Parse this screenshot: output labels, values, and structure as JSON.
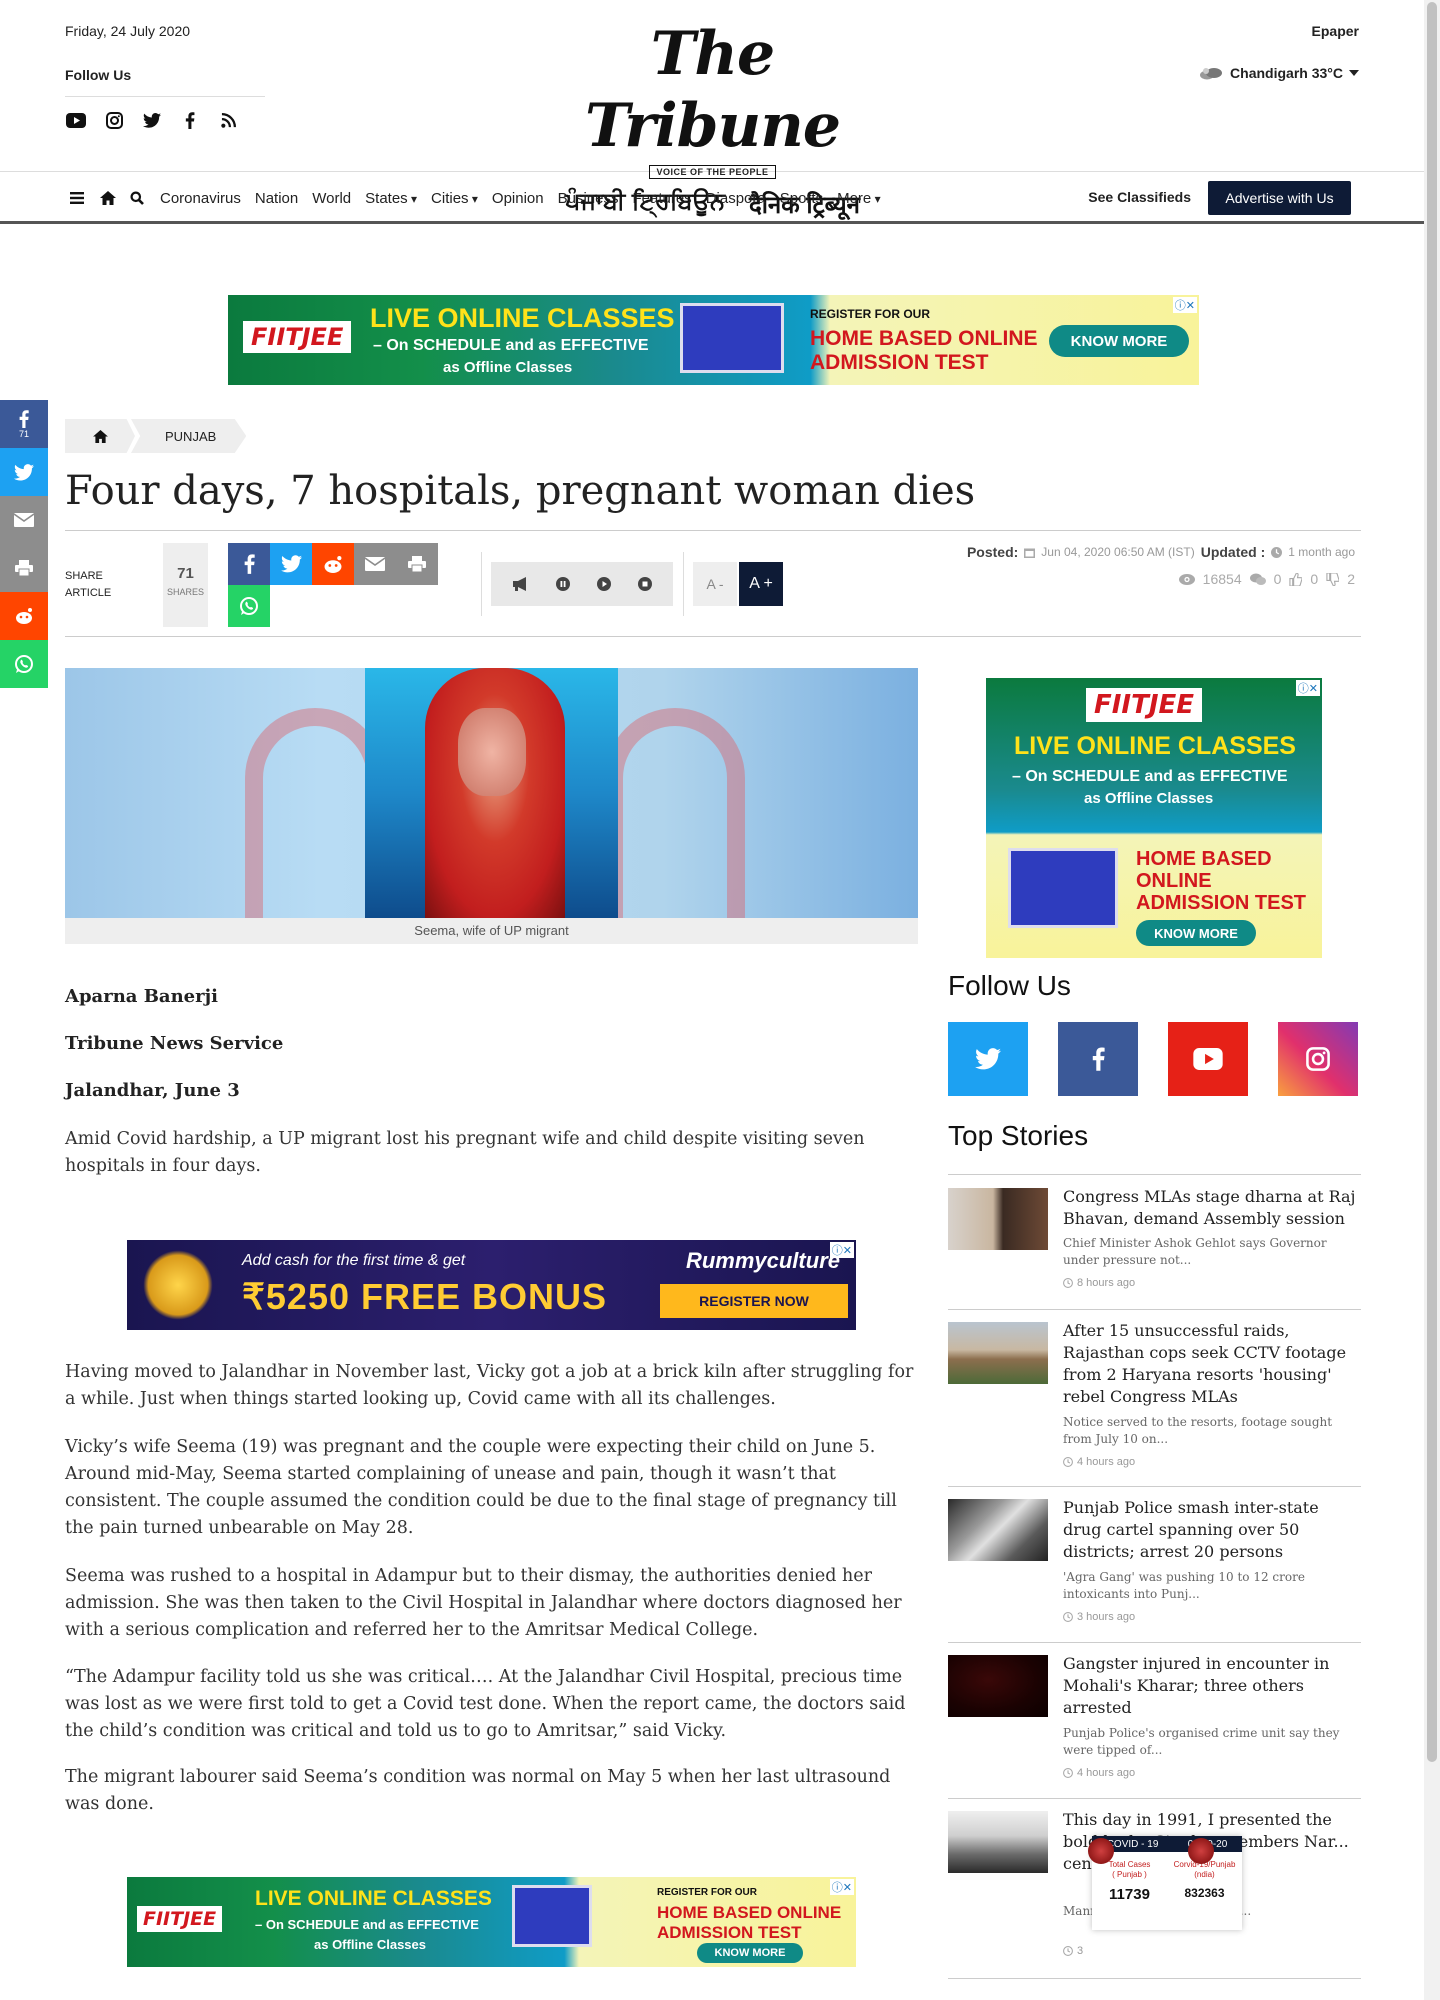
{
  "header": {
    "date": "Friday, 24 July 2020",
    "follow_us": "Follow Us",
    "logo_main": "The Tribune",
    "logo_tagline": "VOICE OF THE PEOPLE",
    "logo_punjabi": "ਪੰਜਾਬੀ ਟ੍ਰਿਬਿਊਨ",
    "logo_hindi": "दैनिक ट्रिब्यून",
    "epaper": "Epaper",
    "weather": "Chandigarh 33°C",
    "social_icons": [
      "youtube-icon",
      "instagram-icon",
      "twitter-icon",
      "facebook-icon",
      "rss-icon"
    ]
  },
  "nav": {
    "items": [
      "Coronavirus",
      "Nation",
      "World",
      "States",
      "Cities",
      "Opinion",
      "Business",
      "Features",
      "Diaspora",
      "Sports",
      "More"
    ],
    "dropdowns": [
      "States",
      "Cities",
      "More"
    ],
    "see_classifieds": "See Classifieds",
    "advertise": "Advertise with Us"
  },
  "ads": {
    "fiitjee_brand": "FIITJEE",
    "fiitjee_live": "LIVE ONLINE CLASSES",
    "fiitjee_sub1": "– On SCHEDULE and as EFFECTIVE",
    "fiitjee_sub2": "as Offline Classes",
    "fiitjee_register": "REGISTER FOR OUR",
    "fiitjee_home1": "HOME BASED ONLINE",
    "fiitjee_home2": "ADMISSION TEST",
    "fiitjee_home_side1": "HOME BASED",
    "fiitjee_home_side2": "ONLINE",
    "fiitjee_home_side3": "ADMISSION TEST",
    "fiitjee_know": "KNOW MORE",
    "rummy_line1": "Add cash for the first time & get",
    "rummy_bonus": "₹5250 FREE BONUS",
    "rummy_logo": "Rummyculture",
    "rummy_register": "REGISTER NOW"
  },
  "float_share": {
    "facebook_count": "71"
  },
  "breadcrumb": {
    "section": "PUNJAB"
  },
  "article": {
    "headline": "Four days, 7 hospitals, pregnant woman dies",
    "share_label_1": "SHARE",
    "share_label_2": "ARTICLE",
    "share_count": "71",
    "shares_word": "SHARES",
    "font_minus": "A -",
    "font_plus": "A +",
    "posted_label": "Posted:",
    "posted_date": "Jun 04, 2020 06:50 AM (IST)",
    "updated_label": "Updated :",
    "updated_ago": "1 month ago",
    "views": "16854",
    "comments": "0",
    "likes": "0",
    "dislikes": "2",
    "caption": "Seema, wife of UP migrant",
    "author": "Aparna Banerji",
    "agency": "Tribune News Service",
    "dateline": "Jalandhar, June 3",
    "paragraphs": [
      "Amid Covid hardship, a UP migrant lost his pregnant wife and child despite visiting seven hospitals in four days.",
      "Having moved to Jalandhar in November last, Vicky got a job at a brick kiln after struggling for a while. Just when things started looking up, Covid came with all its challenges.",
      "Vicky’s wife Seema (19) was pregnant and the couple were expecting their child on June 5. Around mid-May, Seema started complaining of unease and pain, though it wasn’t that consistent. The couple assumed the condition could be due to the final stage of pregnancy till the pain turned unbearable on May 28.",
      "Seema was rushed to a hospital in Adampur but to their dismay, the authorities denied her admission. She was then taken to the Civil Hospital in Jalandhar where doctors diagnosed her with a serious complication and referred her to the Amritsar Medical College.",
      "“The Adampur facility told us she was critical…. At the Jalandhar Civil Hospital, precious time was lost as we were first told to get a Covid test done. When the report came, the doctors said the child’s condition was critical and told us to go to Amritsar,” said Vicky.",
      "The migrant labourer said Seema’s condition was normal on May 5 when her last ultrasound was done."
    ]
  },
  "sidebar": {
    "follow_title": "Follow Us",
    "top_stories_title": "Top Stories",
    "stories": [
      {
        "title": "Congress MLAs stage dharna at Raj Bhavan, demand Assembly session",
        "summary": "Chief Minister Ashok Gehlot says Governor under pressure not...",
        "time": "8 hours ago"
      },
      {
        "title": "After 15 unsuccessful raids, Rajasthan cops seek CCTV footage from 2 Haryana resorts 'housing' rebel Congress MLAs",
        "summary": "Notice served to the resorts, footage sought from July 10 on...",
        "time": "4 hours ago"
      },
      {
        "title": "Punjab Police smash inter-state drug cartel spanning over 50 districts; arrest 20 persons",
        "summary": "'Agra Gang' was pushing 10 to 12 crore intoxicants into Punj...",
        "time": "3 hours ago"
      },
      {
        "title": "Gangster injured in encounter in Mohali's Kharar; three others arrested",
        "summary": "Punjab Police's organised crime unit say they were tipped of...",
        "time": "4 hours ago"
      },
      {
        "title": "This day in 1991, I presented the bold bud... Singh remembers Nar... centenary birth cele...",
        "summary": "Manr... as an important mem...",
        "time": "3"
      }
    ]
  },
  "covid_widget": {
    "title": "COVID - 19",
    "date": "00/10-20",
    "total_label_1": "Total Cases",
    "total_label_2": "( Punjab )",
    "total_value": "11739",
    "india_label_1": "Corvid-19/Punjab",
    "india_label_2": "(ndia)",
    "india_value": "832363"
  }
}
